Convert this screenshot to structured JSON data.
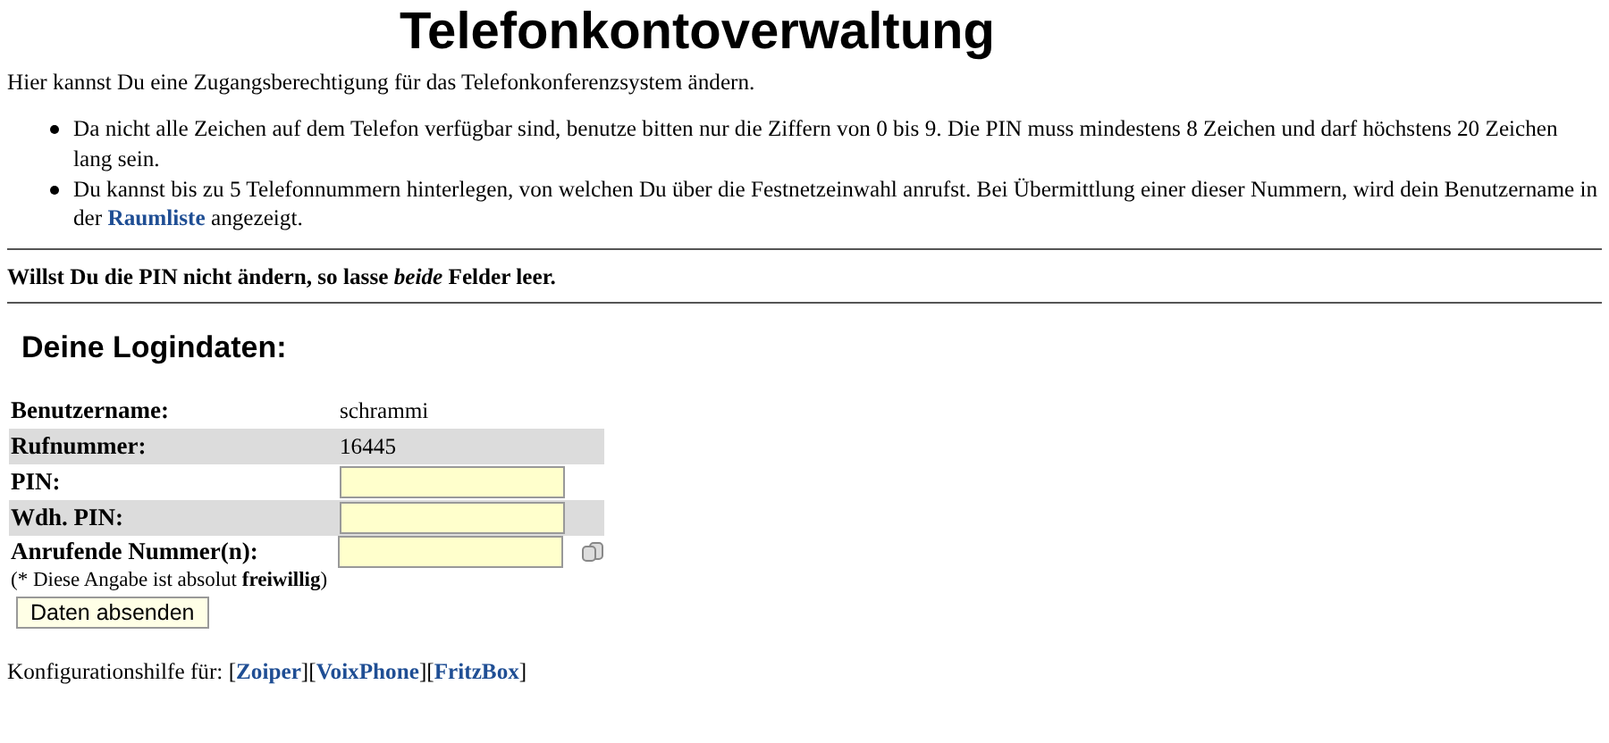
{
  "title": "Telefonkontoverwaltung",
  "intro": "Hier kannst Du eine Zugangsberechtigung für das Telefonkonferenzsystem ändern.",
  "bullets": [
    {
      "text": "Da nicht alle Zeichen auf dem Telefon verfügbar sind, benutze bitten nur die Ziffern von 0 bis 9. Die PIN muss mindestens 8 Zeichen und darf höchstens 20 Zeichen lang sein."
    },
    {
      "text": "Du kannst bis zu 5 Telefonnummern hinterlegen, von welchen Du über die Festnetzeinwahl anrufst. Bei Übermittlung einer dieser Nummern, wird dein Benutzername in der",
      "link": "Raumliste",
      "after": "angezeigt."
    }
  ],
  "notice": "Willst Du die PIN nicht ändern, so lasse *beide* Felder leer.",
  "section_title": "Deine Logindaten:",
  "rows": [
    {
      "kind": "text",
      "label": "Benutzername:",
      "value": "schrammi"
    },
    {
      "kind": "text",
      "label": "Rufnummer:",
      "value": "16445"
    },
    {
      "kind": "input",
      "label": "PIN:"
    },
    {
      "kind": "input",
      "label": "Wdh. PIN:"
    },
    {
      "kind": "input",
      "label": "Anrufende Nummer(n):",
      "note": "(* Diese Angabe ist absolut **freiwillig**)",
      "icon": true
    }
  ],
  "submit": "Daten absenden",
  "config": {
    "label": "Konfigurationshilfe für:",
    "links": [
      {
        "open": "[",
        "text": "Zoiper",
        "close": "]"
      },
      {
        "open": "[",
        "text": "VoixPhone",
        "close": "]"
      },
      {
        "open": "[",
        "text": "FritzBox",
        "close": "]"
      }
    ]
  }
}
